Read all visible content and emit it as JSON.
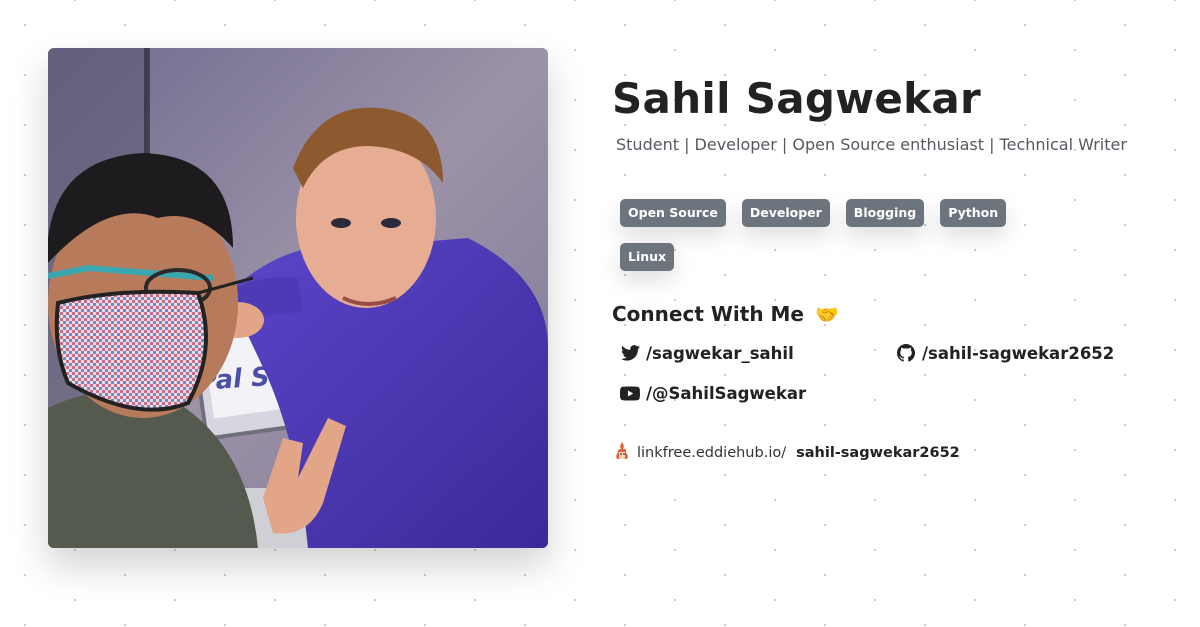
{
  "profile": {
    "name": "Sahil Sagwekar",
    "tagline": "Student | Developer | Open Source enthusiast | Technical Writer",
    "photo_overlay_text": "Pal S"
  },
  "tags": [
    "Open Source",
    "Developer",
    "Blogging",
    "Python",
    "Linux"
  ],
  "connect": {
    "heading": "Connect With Me",
    "emoji": "🤝",
    "twitter": {
      "icon": "twitter-icon",
      "handle": "/sagwekar_sahil"
    },
    "github": {
      "icon": "github-icon",
      "handle": "/sahil-sagwekar2652"
    },
    "youtube": {
      "icon": "youtube-icon",
      "handle": "/@SahilSagwekar"
    }
  },
  "linkfree": {
    "icon": "eddiehub-logo-icon",
    "domain": "linkfree.eddiehub.io/",
    "handle": "sahil-sagwekar2652"
  },
  "colors": {
    "tag_background": "#6c757d",
    "tag_text": "#ffffff",
    "heading_text": "#222222",
    "tagline_text": "#555a60"
  }
}
